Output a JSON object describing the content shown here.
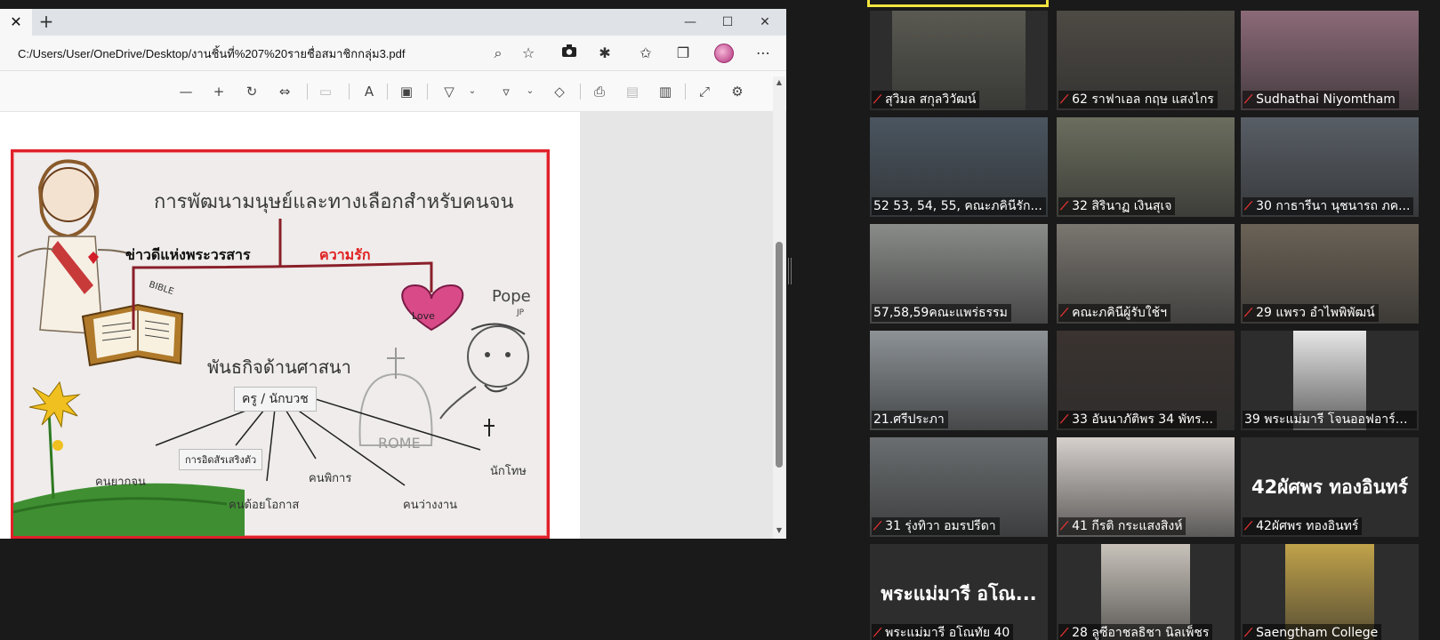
{
  "browser": {
    "tab_close": "✕",
    "new_tab": "+",
    "url": "C:/Users/User/OneDrive/Desktop/งานชิ้นที่%207%20รายชื่อสมาชิกกลุ่ม3.pdf",
    "window_controls": {
      "minimize": "—",
      "maximize": "☐",
      "close": "✕"
    }
  },
  "drawing": {
    "title": "การพัฒนามนุษย์และทางเลือกสำหรับคนจน",
    "good_news": "ข่าวดีแห่งพระวรสาร",
    "love_th": "ความรัก",
    "love_en": "Love",
    "bible": "BIBLE",
    "pope": "Pope",
    "pope_sub": "JP",
    "mission": "พันธกิจด้านศาสนา",
    "teacher": "ครู / นักบวช",
    "rome": "ROME",
    "gift": "การอิดสัรเสริงตัว",
    "poor": "คนยากจน",
    "disabled": "คนพิการ",
    "prisoner": "นักโทษ",
    "underprivileged": "คนด้อยโอกาส",
    "unemployed": "คนว่างงาน"
  },
  "participants": [
    {
      "name": "สุวิมล สกุลวิวัฒน์",
      "muted": true
    },
    {
      "name": "62 ราฟาเอล กฤษ แสงไกร",
      "muted": true
    },
    {
      "name": "Sudhathai Niyomtham",
      "muted": true
    },
    {
      "name": "52 53, 54, 55, คณะภคินีรัก...",
      "muted": false
    },
    {
      "name": "32 สิรินาฏ เงินสุเจ",
      "muted": true
    },
    {
      "name": "30 กาธารีนา นุชนารถ ภค...",
      "muted": true
    },
    {
      "name": "57,58,59คณะแพร่ธรรม",
      "muted": false
    },
    {
      "name": "คณะภคินีผู้รับใช้ฯ",
      "muted": true
    },
    {
      "name": "29 แพรว อำไพพิพัฒน์",
      "muted": true
    },
    {
      "name": "21.ศรีประภา",
      "muted": false
    },
    {
      "name": "33 อันนาภัติพร 34 พัทร...",
      "muted": true
    },
    {
      "name": "39 พระแม่มารี โจนออฟอาร์ค ...",
      "muted": false
    },
    {
      "name": "31 รุ่งทิวา อมรปรีดา",
      "muted": true
    },
    {
      "name": "41 กีรติ กระแสงสิงห์",
      "muted": true
    },
    {
      "name": "42ผัศพร ทองอินทร์",
      "muted": true,
      "big": "42ผัศพร ทองอินทร์"
    },
    {
      "name": "พระแม่มารี อโณทัย 40",
      "muted": true,
      "big": "พระแม่มารี อโณ..."
    },
    {
      "name": "28 ลูซีอาชลธิชา นิลเพ็ชร",
      "muted": true
    },
    {
      "name": "Saengtham College",
      "muted": true
    }
  ],
  "colors": {
    "mic_muted": "#e33",
    "active_speaker": "#f2e43e",
    "drawing_border": "#e0202a"
  }
}
